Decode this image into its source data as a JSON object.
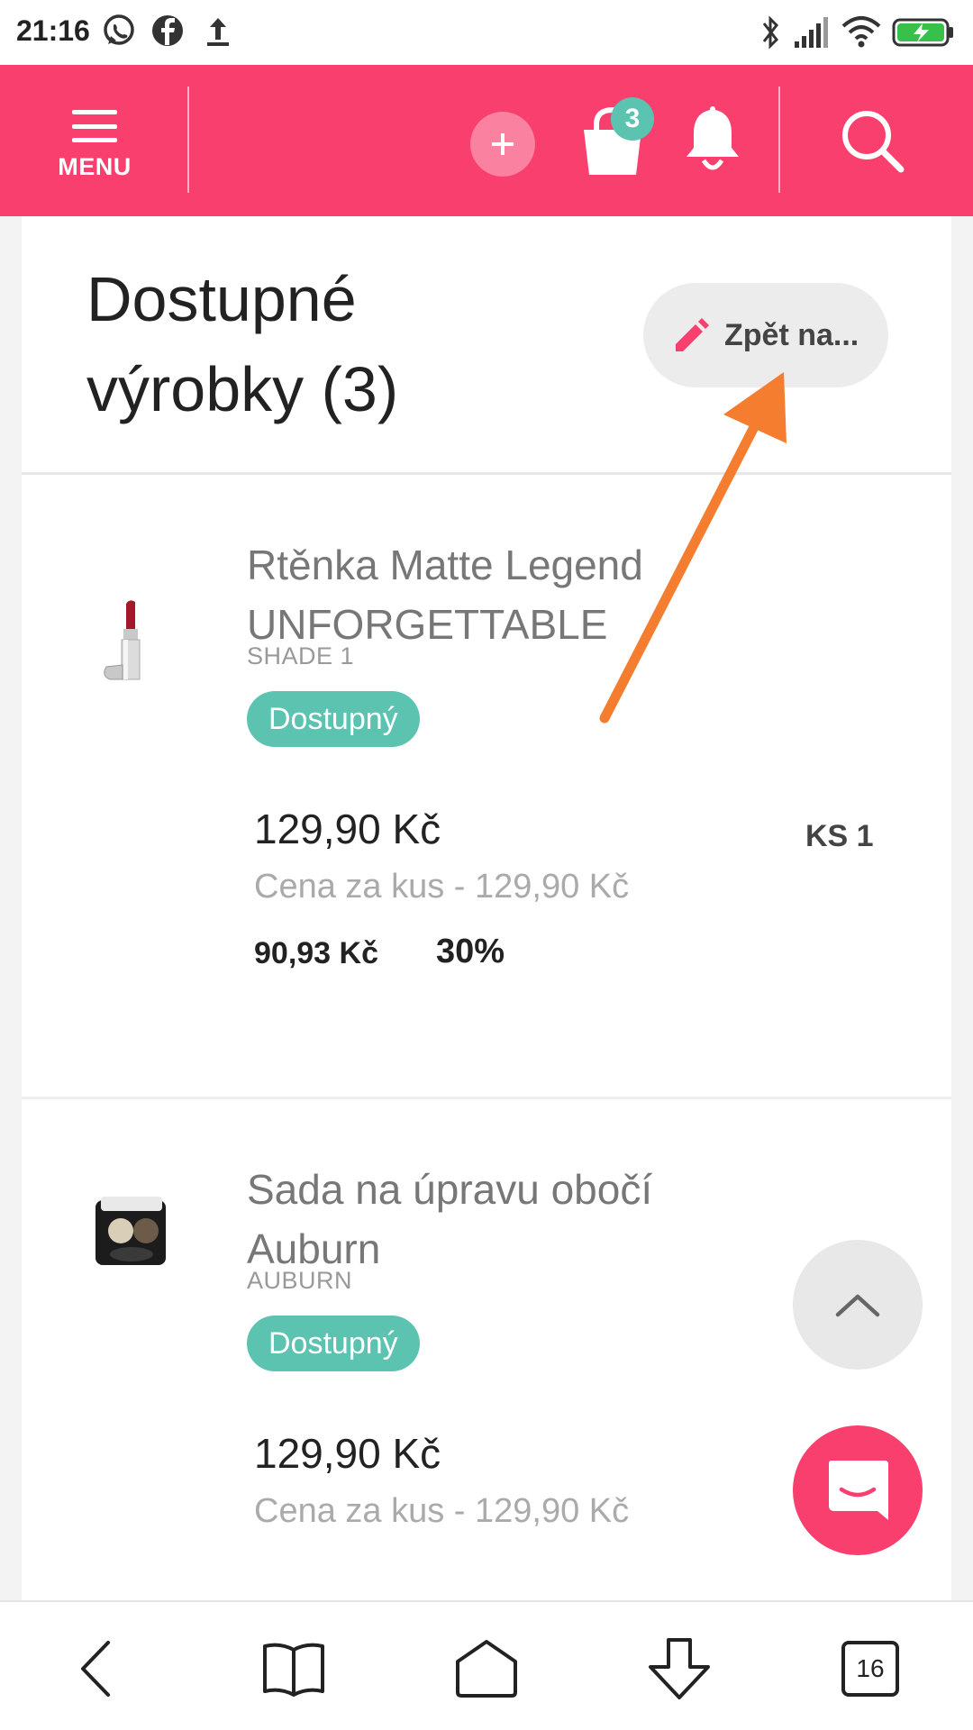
{
  "status_bar": {
    "time": "21:16",
    "left_icons": [
      "whatsapp-icon",
      "facebook-icon",
      "upload-icon"
    ],
    "right_icons": [
      "bluetooth-icon",
      "signal-icon",
      "wifi-icon",
      "battery-charging-icon"
    ]
  },
  "header": {
    "menu_label": "MENU",
    "cart_count": "3",
    "icons": [
      "menu-icon",
      "plus-icon",
      "shopping-bag-icon",
      "bell-icon",
      "search-icon"
    ],
    "brand_color": "#f83f6d"
  },
  "page": {
    "title": "Dostupné výrobky (3)",
    "back_button_label": "Zpět na...",
    "back_button_icon": "pencil-icon"
  },
  "products": [
    {
      "name": "Rtěnka Matte Legend UNFORGETTABLE",
      "variant": "SHADE 1",
      "availability": "Dostupný",
      "price": "129,90 Kč",
      "unit_price": "Cena za kus - 129,90 Kč",
      "quantity": "KS 1",
      "discount_price": "90,93 Kč",
      "discount_percent": "30%",
      "thumbnail": "lipstick-image"
    },
    {
      "name": "Sada na úpravu obočí Auburn",
      "variant": "AUBURN",
      "availability": "Dostupný",
      "price": "129,90 Kč",
      "unit_price": "Cena za kus - 129,90 Kč",
      "thumbnail": "eyebrow-palette-image"
    }
  ],
  "floating": {
    "scroll_top_icon": "chevron-up-icon",
    "chat_icon": "chat-icon"
  },
  "browser_bar": {
    "icons": [
      "back-icon",
      "bookmarks-icon",
      "home-icon",
      "download-icon",
      "tabs-icon"
    ],
    "tabs_count": "16"
  },
  "colors": {
    "accent": "#f83f6d",
    "badge": "#5dc3b1",
    "annotation_arrow": "#f47d2f"
  }
}
